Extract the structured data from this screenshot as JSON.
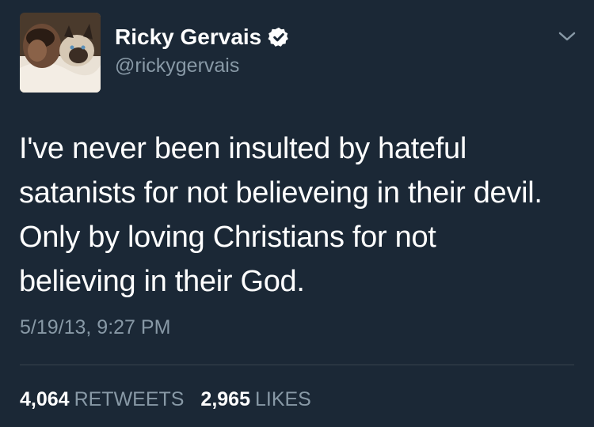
{
  "user": {
    "display_name": "Ricky Gervais",
    "handle": "@rickygervais",
    "verified_icon": "verified-badge-icon",
    "avatar_icon": "profile-photo"
  },
  "menu": {
    "icon": "chevron-down-icon"
  },
  "tweet": {
    "lines": [
      "I've never been insulted by hateful",
      "satanists for not believeing in their devil.",
      "Only by loving Christians for not",
      "believing in their God."
    ],
    "timestamp": "5/19/13, 9:27 PM"
  },
  "stats": {
    "retweets_count": "4,064",
    "retweets_label": "RETWEETS",
    "likes_count": "2,965",
    "likes_label": "LIKES"
  },
  "colors": {
    "background": "#1b2836",
    "primary_text": "#ffffff",
    "secondary_text": "#8899a6",
    "divider": "#38444d"
  }
}
